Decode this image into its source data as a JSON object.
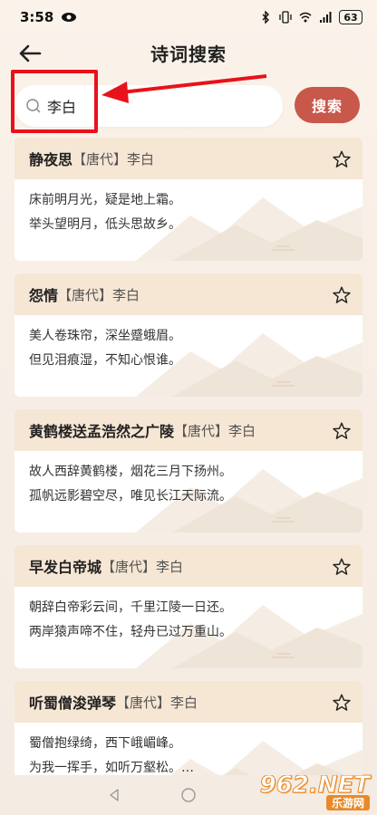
{
  "status_bar": {
    "time": "3:58",
    "battery": "63"
  },
  "header": {
    "title": "诗词搜索"
  },
  "search": {
    "query": "李白",
    "button_label": "搜索"
  },
  "poems": [
    {
      "title": "静夜思",
      "dynasty": "【唐代】",
      "author": "李白",
      "line1": "床前明月光，疑是地上霜。",
      "line2": "举头望明月，低头思故乡。"
    },
    {
      "title": "怨情",
      "dynasty": "【唐代】",
      "author": "李白",
      "line1": "美人卷珠帘，深坐蹙蛾眉。",
      "line2": "但见泪痕湿，不知心恨谁。"
    },
    {
      "title": "黄鹤楼送孟浩然之广陵",
      "dynasty": "【唐代】",
      "author": "李白",
      "line1": "故人西辞黄鹤楼，烟花三月下扬州。",
      "line2": "孤帆远影碧空尽，唯见长江天际流。"
    },
    {
      "title": "早发白帝城",
      "dynasty": "【唐代】",
      "author": "李白",
      "line1": "朝辞白帝彩云间，千里江陵一日还。",
      "line2": "两岸猿声啼不住，轻舟已过万重山。"
    },
    {
      "title": "听蜀僧浚弹琴",
      "dynasty": "【唐代】",
      "author": "李白",
      "line1": "蜀僧抱绿绮，西下峨嵋峰。",
      "line2": "为我一挥手，如听万壑松。…"
    }
  ],
  "watermark": {
    "main": "962.NET",
    "sub": "乐游网"
  },
  "colors": {
    "accent": "#c8584a",
    "card_header": "#f6e6d4",
    "highlight": "#e8121b"
  }
}
